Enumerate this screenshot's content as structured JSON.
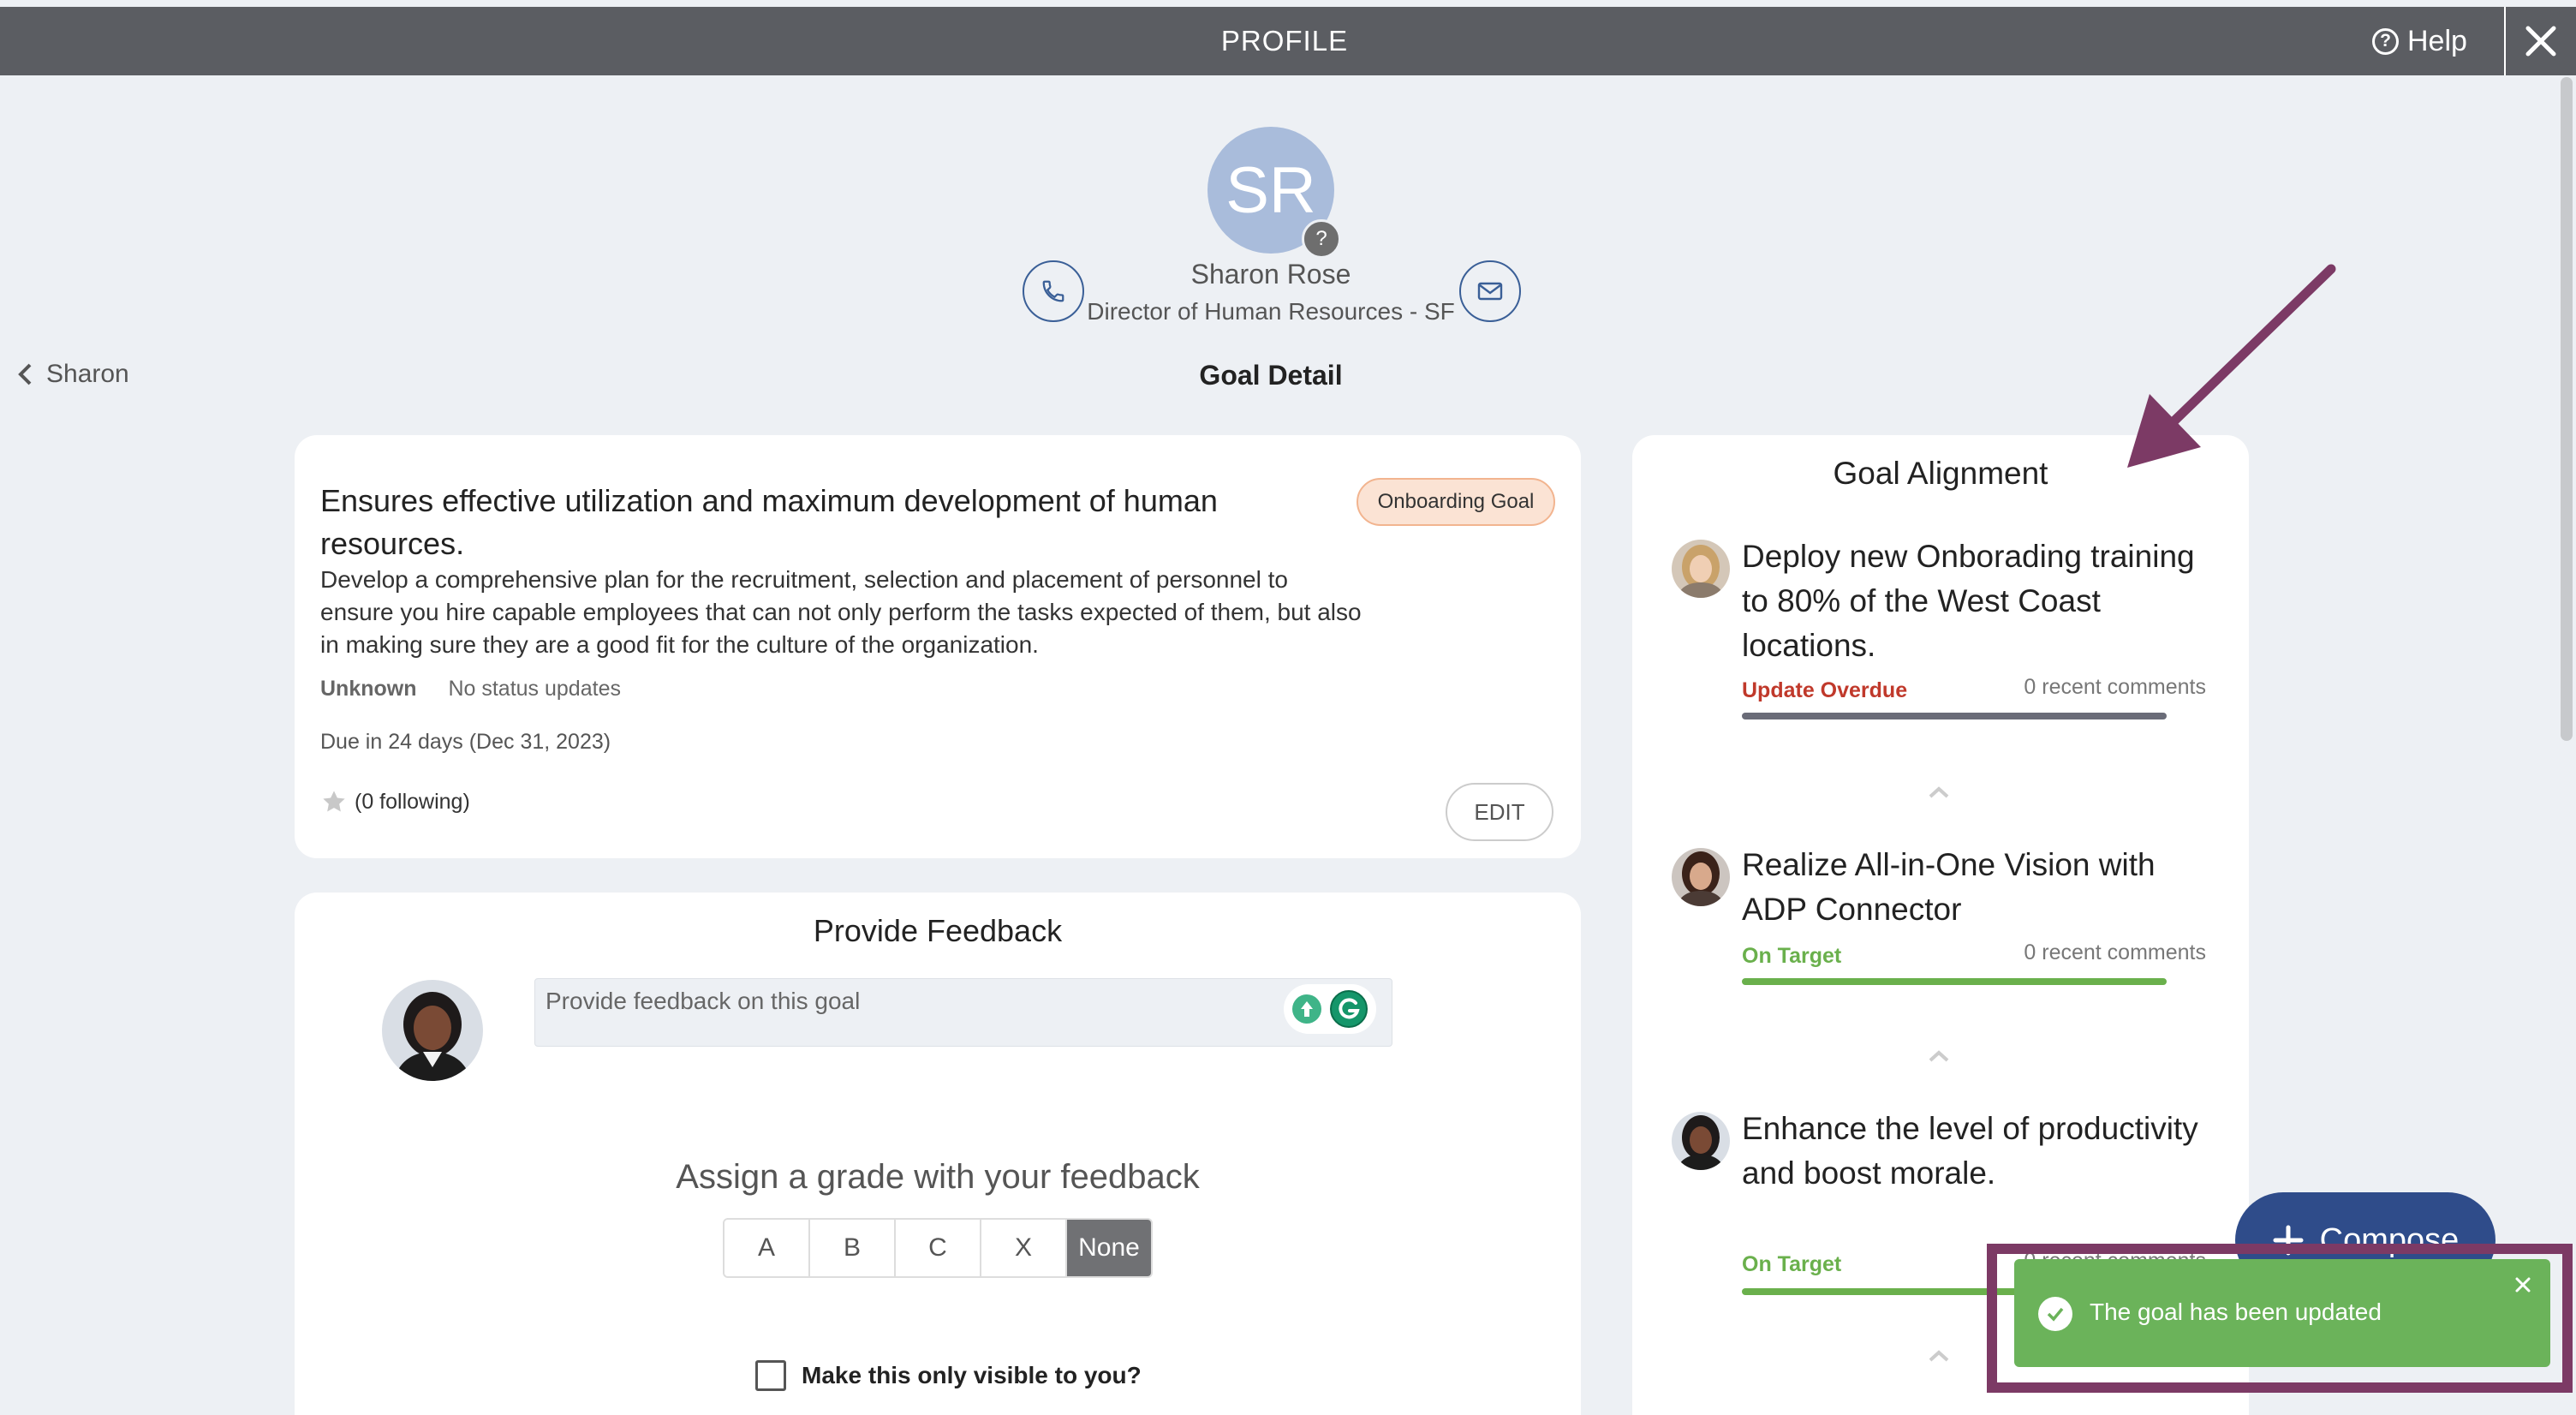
{
  "header": {
    "title": "PROFILE",
    "help_label": "Help"
  },
  "profile": {
    "initials": "SR",
    "badge_glyph": "?",
    "name": "Sharon Rose",
    "role": "Director of Human Resources - SF"
  },
  "nav": {
    "back_label": "Sharon",
    "page_title": "Goal Detail"
  },
  "goal": {
    "title": "Ensures effective utilization and maximum development of human resources.",
    "badge": "Onboarding Goal",
    "description": "Develop a comprehensive plan for the recruitment, selection and placement of personnel to ensure you hire capable employees that can not only perform the tasks expected of them, but also in making sure they are a good fit for the culture of the organization.",
    "status": "Unknown",
    "status_updates": "No status updates",
    "due": "Due in 24 days (Dec 31, 2023)",
    "following": "(0 following)",
    "edit_label": "EDIT"
  },
  "feedback": {
    "title": "Provide Feedback",
    "placeholder": "Provide feedback on this goal",
    "grade_title": "Assign a grade with your feedback",
    "grades": [
      "A",
      "B",
      "C",
      "X",
      "None"
    ],
    "selected_grade": "None",
    "private_label": "Make this only visible to you?"
  },
  "alignment": {
    "title": "Goal Alignment",
    "items": [
      {
        "text": "Deploy new Onborading training to 80% of the West Coast locations.",
        "status": "Update Overdue",
        "status_color": "#c0392b",
        "bar_color": "#6a6c78",
        "comments": "0 recent comments"
      },
      {
        "text": "Realize All-in-One Vision with ADP Connector",
        "status": "On Target",
        "status_color": "#6ab04c",
        "bar_color": "#6ab04c",
        "comments": "0 recent comments"
      },
      {
        "text": "Enhance the level of productivity and boost morale.",
        "status": "On Target",
        "status_color": "#6ab04c",
        "bar_color": "#6ab04c",
        "comments": "0 recent comments"
      }
    ]
  },
  "compose": {
    "label": "Compose"
  },
  "toast": {
    "message": "The goal has been updated"
  },
  "colors": {
    "topbar": "#5b5d62",
    "accent_blue": "#2f4c8a",
    "toast_green": "#6bb35a",
    "annotation": "#7c3a65"
  },
  "icons": [
    "help-icon",
    "close-icon",
    "phone-icon",
    "mail-icon",
    "chevron-left-icon",
    "star-icon",
    "grammarly-icon",
    "chevron-up-icon",
    "plus-icon",
    "check-icon",
    "toast-close-icon",
    "annotation-arrow"
  ]
}
